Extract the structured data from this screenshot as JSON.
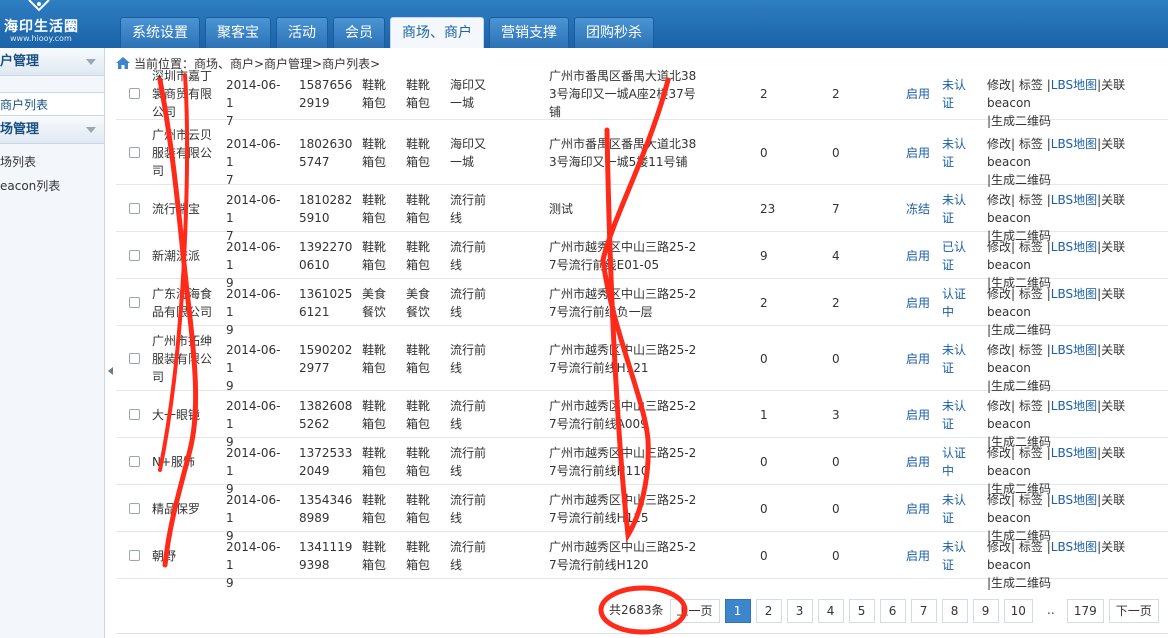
{
  "logo": {
    "name": "海印生活圈",
    "url": "www.hiooy.com"
  },
  "tabs": [
    "系统设置",
    "聚客宝",
    "活动",
    "会员",
    "商场、商户",
    "营销支撑",
    "团购秒杀"
  ],
  "active_tab": 4,
  "sidebar": {
    "group1": "户管理",
    "item_active": "商户列表",
    "group2": "场管理",
    "items": [
      "场列表",
      "eacon列表"
    ]
  },
  "breadcrumb": "当前位置：商场、商户>商户管理>商户列表>",
  "rows": [
    {
      "name": [
        "深圳市嘉丁",
        "裳商贸有限",
        "公司"
      ],
      "date": [
        "2014-06-1",
        "7"
      ],
      "phone": [
        "1587656",
        "2919"
      ],
      "cat1": [
        "鞋靴",
        "箱包"
      ],
      "cat2": [
        "鞋靴",
        "箱包"
      ],
      "mall": [
        "海印又",
        "一城"
      ],
      "addr": [
        "广州市番禺区番禺大道北38",
        "3号海印又一城A座2楼37号",
        "铺"
      ],
      "n1": "2",
      "n2": "2",
      "status": "启用",
      "auth": [
        "未认",
        "证"
      ]
    },
    {
      "name": [
        "广州市云贝",
        "服装有限公",
        "司"
      ],
      "date": [
        "2014-06-1",
        "7"
      ],
      "phone": [
        "1802630",
        "5747"
      ],
      "cat1": [
        "鞋靴",
        "箱包"
      ],
      "cat2": [
        "鞋靴",
        "箱包"
      ],
      "mall": [
        "海印又",
        "一城"
      ],
      "addr": [
        "广州市番禺区番禺大道北38",
        "3号海印又一城5楼11号铺"
      ],
      "n1": "0",
      "n2": "0",
      "status": "启用",
      "auth": [
        "未认",
        "证"
      ]
    },
    {
      "name": [
        "流行瑞宝"
      ],
      "date": [
        "2014-06-1",
        "7"
      ],
      "phone": [
        "1810282",
        "5910"
      ],
      "cat1": [
        "鞋靴",
        "箱包"
      ],
      "cat2": [
        "鞋靴",
        "箱包"
      ],
      "mall": [
        "流行前",
        "线"
      ],
      "addr": [
        "测试"
      ],
      "n1": "23",
      "n2": "7",
      "status": "冻结",
      "auth": [
        "未认",
        "证"
      ]
    },
    {
      "name": [
        "新潮流派"
      ],
      "date": [
        "2014-06-1",
        "9"
      ],
      "phone": [
        "1392270",
        "0610"
      ],
      "cat1": [
        "鞋靴",
        "箱包"
      ],
      "cat2": [
        "鞋靴",
        "箱包"
      ],
      "mall": [
        "流行前",
        "线"
      ],
      "addr": [
        "广州市越秀区中山三路25-2",
        "7号流行前线E01-05"
      ],
      "n1": "9",
      "n2": "4",
      "status": "启用",
      "auth": [
        "已认",
        "证"
      ]
    },
    {
      "name": [
        "广东海海食",
        "品有限公司"
      ],
      "date": [
        "2014-06-1",
        "9"
      ],
      "phone": [
        "1361025",
        "6121"
      ],
      "cat1": [
        "美食",
        "餐饮"
      ],
      "cat2": [
        "美食",
        "餐饮"
      ],
      "mall": [
        "流行前",
        "线"
      ],
      "addr": [
        "广州市越秀区中山三路25-2",
        "7号流行前线负一层"
      ],
      "n1": "2",
      "n2": "2",
      "status": "启用",
      "auth": [
        "认证",
        "中"
      ]
    },
    {
      "name": [
        "广州市拓绅",
        "服装有限公",
        "司"
      ],
      "date": [
        "2014-06-1",
        "9"
      ],
      "phone": [
        "1590202",
        "2977"
      ],
      "cat1": [
        "鞋靴",
        "箱包"
      ],
      "cat2": [
        "鞋靴",
        "箱包"
      ],
      "mall": [
        "流行前",
        "线"
      ],
      "addr": [
        "广州市越秀区中山三路25-2",
        "7号流行前线H121"
      ],
      "n1": "0",
      "n2": "0",
      "status": "启用",
      "auth": [
        "未认",
        "证"
      ]
    },
    {
      "name": [
        "大一眼镜"
      ],
      "date": [
        "2014-06-1",
        "9"
      ],
      "phone": [
        "1382608",
        "5262"
      ],
      "cat1": [
        "鞋靴",
        "箱包"
      ],
      "cat2": [
        "鞋靴",
        "箱包"
      ],
      "mall": [
        "流行前",
        "线"
      ],
      "addr": [
        "广州市越秀区中山三路25-2",
        "7号流行前线A009"
      ],
      "n1": "1",
      "n2": "3",
      "status": "启用",
      "auth": [
        "未认",
        "证"
      ]
    },
    {
      "name": [
        "N+服饰"
      ],
      "date": [
        "2014-06-1",
        "9"
      ],
      "phone": [
        "1372533",
        "2049"
      ],
      "cat1": [
        "鞋靴",
        "箱包"
      ],
      "cat2": [
        "鞋靴",
        "箱包"
      ],
      "mall": [
        "流行前",
        "线"
      ],
      "addr": [
        "广州市越秀区中山三路25-2",
        "7号流行前线H110"
      ],
      "n1": "0",
      "n2": "0",
      "status": "启用",
      "auth": [
        "认证",
        "中"
      ]
    },
    {
      "name": [
        "精品保罗"
      ],
      "date": [
        "2014-06-1",
        "9"
      ],
      "phone": [
        "1354346",
        "8989"
      ],
      "cat1": [
        "鞋靴",
        "箱包"
      ],
      "cat2": [
        "鞋靴",
        "箱包"
      ],
      "mall": [
        "流行前",
        "线"
      ],
      "addr": [
        "广州市越秀区中山三路25-2",
        "7号流行前线H115"
      ],
      "n1": "0",
      "n2": "0",
      "status": "启用",
      "auth": [
        "未认",
        "证"
      ]
    },
    {
      "name": [
        "朝野"
      ],
      "date": [
        "2014-06-1",
        "9"
      ],
      "phone": [
        "1341119",
        "9398"
      ],
      "cat1": [
        "鞋靴",
        "箱包"
      ],
      "cat2": [
        "鞋靴",
        "箱包"
      ],
      "mall": [
        "流行前",
        "线"
      ],
      "addr": [
        "广州市越秀区中山三路25-2",
        "7号流行前线H120"
      ],
      "n1": "0",
      "n2": "0",
      "status": "启用",
      "auth": [
        "未认",
        "证"
      ]
    }
  ],
  "ops": {
    "edit": "修改|",
    "tag": "标签",
    "sep1": "|",
    "lbs": "LBS地图",
    "link": "|关联beacon",
    "qr": "|生成二维码"
  },
  "pager": {
    "total": "共2683条",
    "prev": "上一页",
    "pages": [
      "1",
      "2",
      "3",
      "4",
      "5",
      "6",
      "7",
      "8",
      "9",
      "10"
    ],
    "ellipsis": "..",
    "last": "179",
    "next": "下一页",
    "current": "1"
  },
  "colors": {
    "header": "#1a63a8",
    "link": "#1a5fa8",
    "annotation": "#ff2a1a"
  }
}
